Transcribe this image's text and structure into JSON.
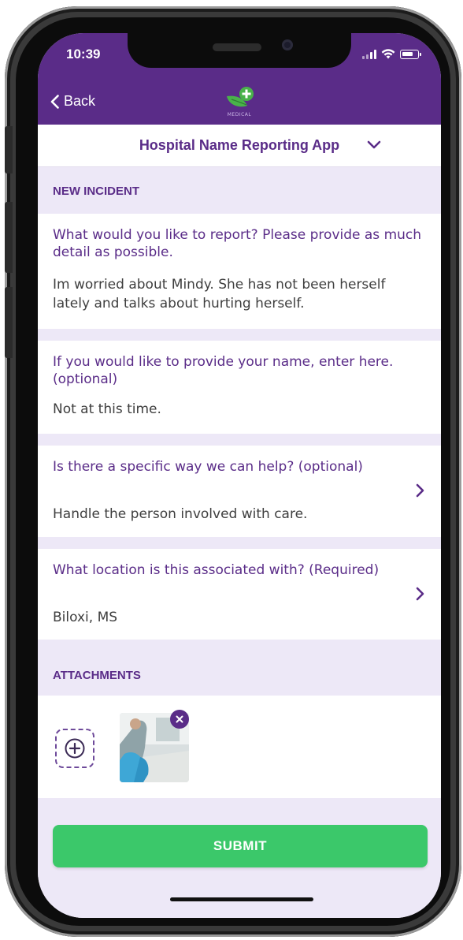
{
  "status_bar": {
    "time": "10:39",
    "icons": [
      "signal-icon",
      "wifi-icon",
      "battery-icon"
    ]
  },
  "nav": {
    "back_label": "Back",
    "logo_text": "MEDICAL",
    "logo_icon": "medical-leaf-cross-icon"
  },
  "header": {
    "title": "Hospital Name Reporting App",
    "dropdown_icon": "chevron-down-icon"
  },
  "sections": {
    "new_incident_label": "NEW INCIDENT",
    "attachments_label": "ATTACHMENTS"
  },
  "fields": [
    {
      "question": "What would you like to report? Please provide as much detail as possible.",
      "answer": "Im worried about Mindy. She has not been herself lately and talks about hurting herself."
    },
    {
      "question": "If you would like to provide your name, enter here. (optional)",
      "answer": "Not at this time."
    },
    {
      "question": "Is there a specific way we can help? (optional)",
      "answer": "Handle the person involved with care."
    },
    {
      "question": "What location is this associated with? (Required)",
      "answer": "Biloxi, MS"
    }
  ],
  "attachments": {
    "add_icon": "plus-circle-icon",
    "remove_icon": "close-icon",
    "items": [
      "photo-thumbnail"
    ]
  },
  "footer": {
    "submit_label": "SUBMIT"
  },
  "colors": {
    "brand_purple": "#5a2c88",
    "section_bg": "#ede8f7",
    "submit_green": "#3bc86a",
    "logo_green": "#49b24a"
  }
}
